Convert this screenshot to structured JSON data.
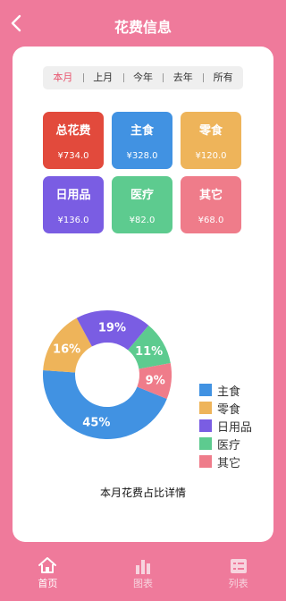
{
  "app": {
    "title": "花费信息",
    "back_icon": "chevron-left-icon"
  },
  "periods": {
    "items": [
      "本月",
      "上月",
      "今年",
      "去年",
      "所有"
    ],
    "active": 0
  },
  "categories": [
    {
      "label": "总花费",
      "value": "¥734.0",
      "color": "#E24A3C"
    },
    {
      "label": "主食",
      "value": "¥328.0",
      "color": "#4192E2"
    },
    {
      "label": "零食",
      "value": "¥120.0",
      "color": "#EEB45A"
    },
    {
      "label": "日用品",
      "value": "¥136.0",
      "color": "#7A5DE3"
    },
    {
      "label": "医疗",
      "value": "¥82.0",
      "color": "#5DCB8F"
    },
    {
      "label": "其它",
      "value": "¥68.0",
      "color": "#EF7C8A"
    }
  ],
  "chart_data": {
    "type": "pie",
    "donut": true,
    "labels": [
      "主食",
      "零食",
      "日用品",
      "医疗",
      "其它"
    ],
    "values": [
      45,
      16,
      19,
      11,
      9
    ],
    "data_labels": [
      "45%",
      "16%",
      "19%",
      "11%",
      "9%"
    ],
    "colors": [
      "#4192E2",
      "#EEB45A",
      "#7A5DE3",
      "#5DCB8F",
      "#EF7C8A"
    ],
    "title": "本月花费占比详情",
    "legend": "right"
  },
  "tabbar": {
    "items": [
      {
        "label": "首页",
        "icon": "home-icon",
        "active": true
      },
      {
        "label": "图表",
        "icon": "bar-chart-icon",
        "active": false
      },
      {
        "label": "列表",
        "icon": "list-icon",
        "active": false
      }
    ]
  }
}
